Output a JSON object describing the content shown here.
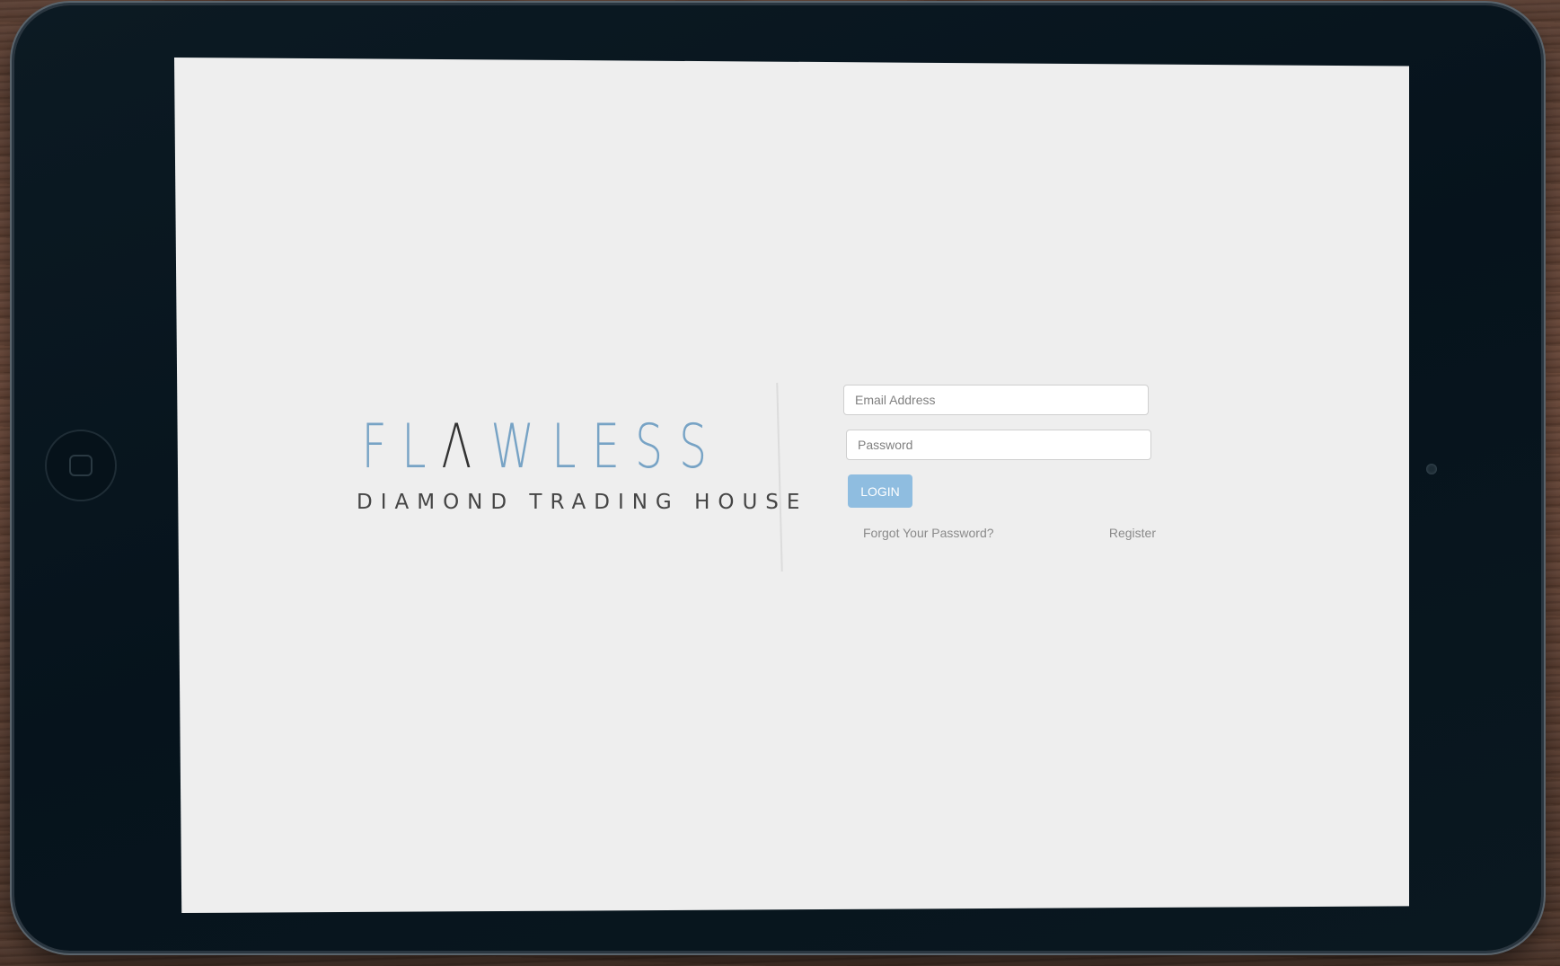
{
  "logo": {
    "letters": [
      "F",
      "L",
      "Λ",
      "W",
      "L",
      "E",
      "S",
      "S"
    ],
    "tagline": "DIAMOND TRADING HOUSE"
  },
  "login_form": {
    "email_placeholder": "Email Address",
    "password_placeholder": "Password",
    "login_label": "LOGIN",
    "forgot_password_label": "Forgot Your Password?",
    "register_label": "Register"
  },
  "colors": {
    "brand_blue": "#77a3c5",
    "login_button": "#8fbde0",
    "screen_background": "#eeeeee"
  }
}
